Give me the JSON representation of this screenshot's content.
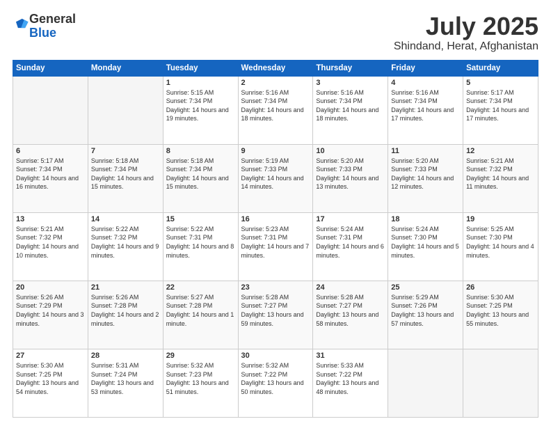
{
  "logo": {
    "general": "General",
    "blue": "Blue"
  },
  "header": {
    "month": "July 2025",
    "location": "Shindand, Herat, Afghanistan"
  },
  "weekdays": [
    "Sunday",
    "Monday",
    "Tuesday",
    "Wednesday",
    "Thursday",
    "Friday",
    "Saturday"
  ],
  "weeks": [
    [
      {
        "day": "",
        "empty": true
      },
      {
        "day": "",
        "empty": true
      },
      {
        "day": "1",
        "sunrise": "5:15 AM",
        "sunset": "7:34 PM",
        "daylight": "14 hours and 19 minutes."
      },
      {
        "day": "2",
        "sunrise": "5:16 AM",
        "sunset": "7:34 PM",
        "daylight": "14 hours and 18 minutes."
      },
      {
        "day": "3",
        "sunrise": "5:16 AM",
        "sunset": "7:34 PM",
        "daylight": "14 hours and 18 minutes."
      },
      {
        "day": "4",
        "sunrise": "5:16 AM",
        "sunset": "7:34 PM",
        "daylight": "14 hours and 17 minutes."
      },
      {
        "day": "5",
        "sunrise": "5:17 AM",
        "sunset": "7:34 PM",
        "daylight": "14 hours and 17 minutes."
      }
    ],
    [
      {
        "day": "6",
        "sunrise": "5:17 AM",
        "sunset": "7:34 PM",
        "daylight": "14 hours and 16 minutes."
      },
      {
        "day": "7",
        "sunrise": "5:18 AM",
        "sunset": "7:34 PM",
        "daylight": "14 hours and 15 minutes."
      },
      {
        "day": "8",
        "sunrise": "5:18 AM",
        "sunset": "7:34 PM",
        "daylight": "14 hours and 15 minutes."
      },
      {
        "day": "9",
        "sunrise": "5:19 AM",
        "sunset": "7:33 PM",
        "daylight": "14 hours and 14 minutes."
      },
      {
        "day": "10",
        "sunrise": "5:20 AM",
        "sunset": "7:33 PM",
        "daylight": "14 hours and 13 minutes."
      },
      {
        "day": "11",
        "sunrise": "5:20 AM",
        "sunset": "7:33 PM",
        "daylight": "14 hours and 12 minutes."
      },
      {
        "day": "12",
        "sunrise": "5:21 AM",
        "sunset": "7:32 PM",
        "daylight": "14 hours and 11 minutes."
      }
    ],
    [
      {
        "day": "13",
        "sunrise": "5:21 AM",
        "sunset": "7:32 PM",
        "daylight": "14 hours and 10 minutes."
      },
      {
        "day": "14",
        "sunrise": "5:22 AM",
        "sunset": "7:32 PM",
        "daylight": "14 hours and 9 minutes."
      },
      {
        "day": "15",
        "sunrise": "5:22 AM",
        "sunset": "7:31 PM",
        "daylight": "14 hours and 8 minutes."
      },
      {
        "day": "16",
        "sunrise": "5:23 AM",
        "sunset": "7:31 PM",
        "daylight": "14 hours and 7 minutes."
      },
      {
        "day": "17",
        "sunrise": "5:24 AM",
        "sunset": "7:31 PM",
        "daylight": "14 hours and 6 minutes."
      },
      {
        "day": "18",
        "sunrise": "5:24 AM",
        "sunset": "7:30 PM",
        "daylight": "14 hours and 5 minutes."
      },
      {
        "day": "19",
        "sunrise": "5:25 AM",
        "sunset": "7:30 PM",
        "daylight": "14 hours and 4 minutes."
      }
    ],
    [
      {
        "day": "20",
        "sunrise": "5:26 AM",
        "sunset": "7:29 PM",
        "daylight": "14 hours and 3 minutes."
      },
      {
        "day": "21",
        "sunrise": "5:26 AM",
        "sunset": "7:28 PM",
        "daylight": "14 hours and 2 minutes."
      },
      {
        "day": "22",
        "sunrise": "5:27 AM",
        "sunset": "7:28 PM",
        "daylight": "14 hours and 1 minute."
      },
      {
        "day": "23",
        "sunrise": "5:28 AM",
        "sunset": "7:27 PM",
        "daylight": "13 hours and 59 minutes."
      },
      {
        "day": "24",
        "sunrise": "5:28 AM",
        "sunset": "7:27 PM",
        "daylight": "13 hours and 58 minutes."
      },
      {
        "day": "25",
        "sunrise": "5:29 AM",
        "sunset": "7:26 PM",
        "daylight": "13 hours and 57 minutes."
      },
      {
        "day": "26",
        "sunrise": "5:30 AM",
        "sunset": "7:25 PM",
        "daylight": "13 hours and 55 minutes."
      }
    ],
    [
      {
        "day": "27",
        "sunrise": "5:30 AM",
        "sunset": "7:25 PM",
        "daylight": "13 hours and 54 minutes."
      },
      {
        "day": "28",
        "sunrise": "5:31 AM",
        "sunset": "7:24 PM",
        "daylight": "13 hours and 53 minutes."
      },
      {
        "day": "29",
        "sunrise": "5:32 AM",
        "sunset": "7:23 PM",
        "daylight": "13 hours and 51 minutes."
      },
      {
        "day": "30",
        "sunrise": "5:32 AM",
        "sunset": "7:22 PM",
        "daylight": "13 hours and 50 minutes."
      },
      {
        "day": "31",
        "sunrise": "5:33 AM",
        "sunset": "7:22 PM",
        "daylight": "13 hours and 48 minutes."
      },
      {
        "day": "",
        "empty": true
      },
      {
        "day": "",
        "empty": true
      }
    ]
  ]
}
